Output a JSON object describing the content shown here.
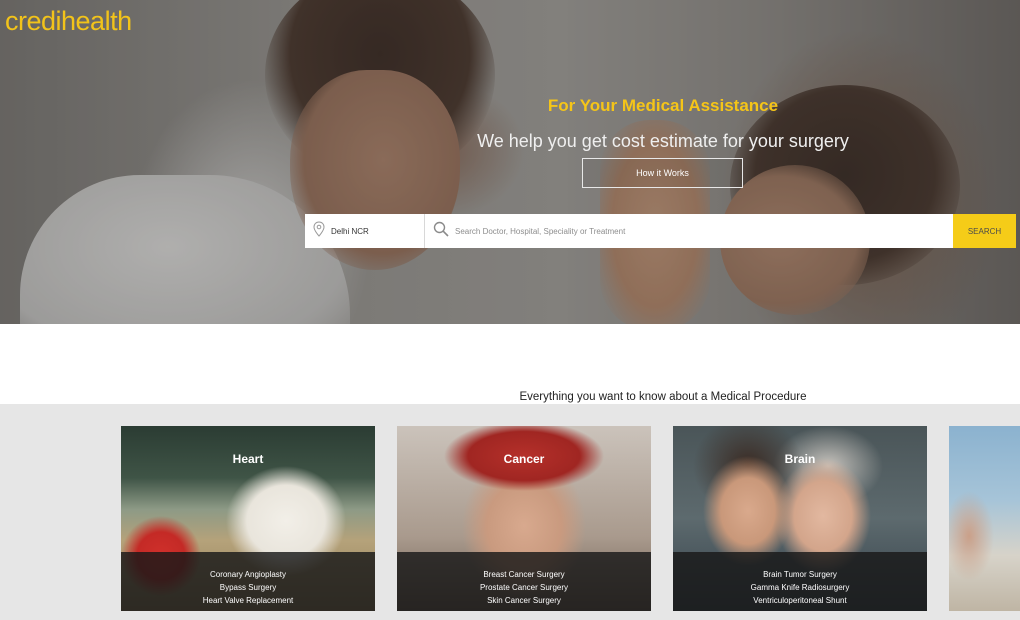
{
  "brand": {
    "logo_text": "credihealth",
    "accent_color": "#f5c518"
  },
  "hero": {
    "title": "For Your Medical Assistance",
    "subtitle": "We help you get cost estimate for your surgery",
    "how_button": "How it Works"
  },
  "search": {
    "location_icon": "location-pin-icon",
    "location_value": "Delhi NCR",
    "search_icon": "search-icon",
    "placeholder": "Search Doctor, Hospital, Speciality or Treatment",
    "button_label": "SEARCH",
    "button_color": "#f5cc18"
  },
  "procedures": {
    "heading": "Everything you want to know about a Medical Procedure",
    "cards": [
      {
        "category": "Heart",
        "items": [
          "Coronary Angioplasty",
          "Bypass Surgery",
          "Heart Valve Replacement"
        ]
      },
      {
        "category": "Cancer",
        "items": [
          "Breast Cancer Surgery",
          "Prostate Cancer Surgery",
          "Skin Cancer Surgery"
        ]
      },
      {
        "category": "Brain",
        "items": [
          "Brain Tumor Surgery",
          "Gamma Knife Radiosurgery",
          "Ventriculoperitoneal Shunt"
        ]
      }
    ]
  }
}
